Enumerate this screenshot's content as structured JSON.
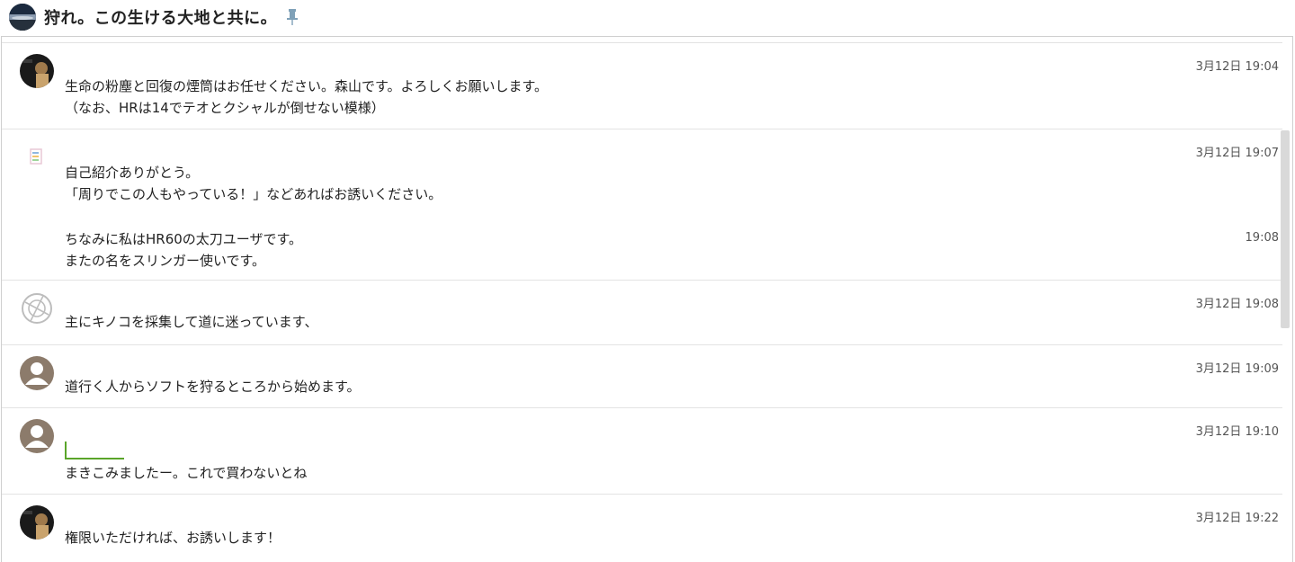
{
  "room": {
    "title": "狩れ。この生ける大地と共に。",
    "icon": "room-avatar-icon",
    "pin_icon": "pin-icon",
    "pin_color": "#7fa1b8"
  },
  "messages": [
    {
      "avatar": "avatar-photo-icon",
      "time": "3月12日 19:04",
      "lines": [
        "生命の粉塵と回復の煙筒はお任せください。森山です。よろしくお願いします。",
        "（なお、HRは14でテオとクシャルが倒せない模様）"
      ]
    },
    {
      "avatar": "avatar-colorful-icon",
      "time": "3月12日 19:07",
      "lines": [
        "自己紹介ありがとう。",
        "「周りでこの人もやっている！」などあればお誘いください。"
      ],
      "followup_time": "19:08",
      "followup_lines": [
        "ちなみに私はHR60の太刀ユーザです。",
        "またの名をスリンガー使いです。"
      ]
    },
    {
      "avatar": "avatar-globe-icon",
      "time": "3月12日 19:08",
      "lines": [
        "主にキノコを採集して道に迷っています、"
      ]
    },
    {
      "avatar": "avatar-default-user-icon",
      "time": "3月12日 19:09",
      "lines": [
        "道行く人からソフトを狩るところから始めます。"
      ]
    },
    {
      "avatar": "avatar-default-user-icon",
      "time": "3月12日 19:10",
      "lines": [
        "まきこみましたー。これで買わないとね"
      ]
    },
    {
      "avatar": "avatar-photo-icon",
      "time": "3月12日 19:22",
      "lines": [
        "権限いただければ、お誘いします！"
      ]
    }
  ]
}
